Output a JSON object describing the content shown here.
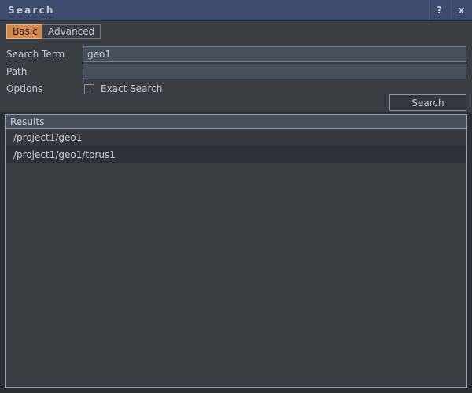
{
  "window": {
    "title": "Search",
    "help_button": "?",
    "close_button": "x"
  },
  "tabs": [
    {
      "id": "basic",
      "label": "Basic",
      "selected": true
    },
    {
      "id": "advanced",
      "label": "Advanced",
      "selected": false
    }
  ],
  "form": {
    "search_term": {
      "label": "Search Term",
      "value": "geo1",
      "placeholder": ""
    },
    "path": {
      "label": "Path",
      "value": "",
      "placeholder": ""
    },
    "options": {
      "label": "Options",
      "exact_search_label": "Exact Search",
      "exact_search_checked": false
    },
    "search_button_label": "Search"
  },
  "results": {
    "header": "Results",
    "rows": [
      "/project1/geo1",
      "/project1/geo1/torus1"
    ]
  },
  "colors": {
    "titlebar": "#3d4c6e",
    "panel": "#3a3d42",
    "window_background": "#2b2e33",
    "accent_tab": "#d7894c",
    "input_fill": "#474f5d",
    "border": "#9aa1ac",
    "text": "#c4c9d2"
  }
}
